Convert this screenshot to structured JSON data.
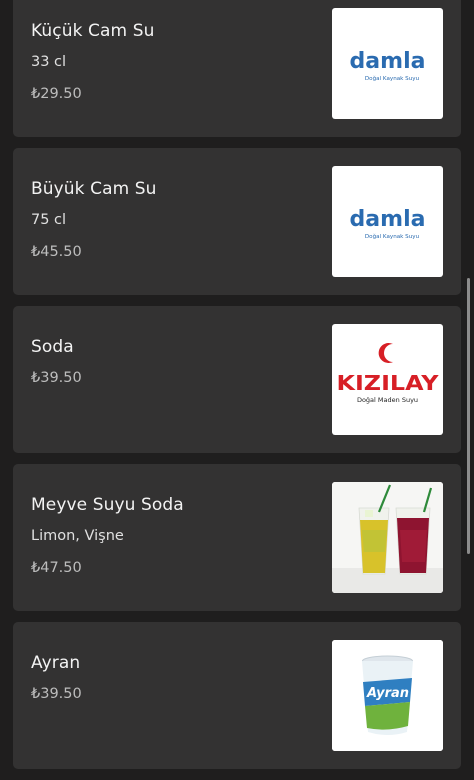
{
  "menu": {
    "items": [
      {
        "name": "Küçük Cam Su",
        "description": "33 cl",
        "price": "₺29.50",
        "image": "damla-logo"
      },
      {
        "name": "Büyük Cam Su",
        "description": "75 cl",
        "price": "₺45.50",
        "image": "damla-logo"
      },
      {
        "name": "Soda",
        "description": "",
        "price": "₺39.50",
        "image": "kizilay-logo"
      },
      {
        "name": "Meyve Suyu Soda",
        "description": "Limon, Vişne",
        "price": "₺47.50",
        "image": "fruit-soda-glasses-photo"
      },
      {
        "name": "Ayran",
        "description": "",
        "price": "₺39.50",
        "image": "ayran-cup-photo"
      }
    ]
  },
  "logos": {
    "damla": {
      "brand": "damla",
      "tagline": "Doğal Kaynak Suyu"
    },
    "kizilay": {
      "brand": "KIZILAY",
      "tagline": "Doğal Maden Suyu"
    },
    "ayran_cup": {
      "brand": "Ayran"
    }
  },
  "colors": {
    "background": "#1f1e1e",
    "card": "#333232",
    "damla_blue": "#2a6bb0",
    "kizilay_red": "#d71f26"
  }
}
